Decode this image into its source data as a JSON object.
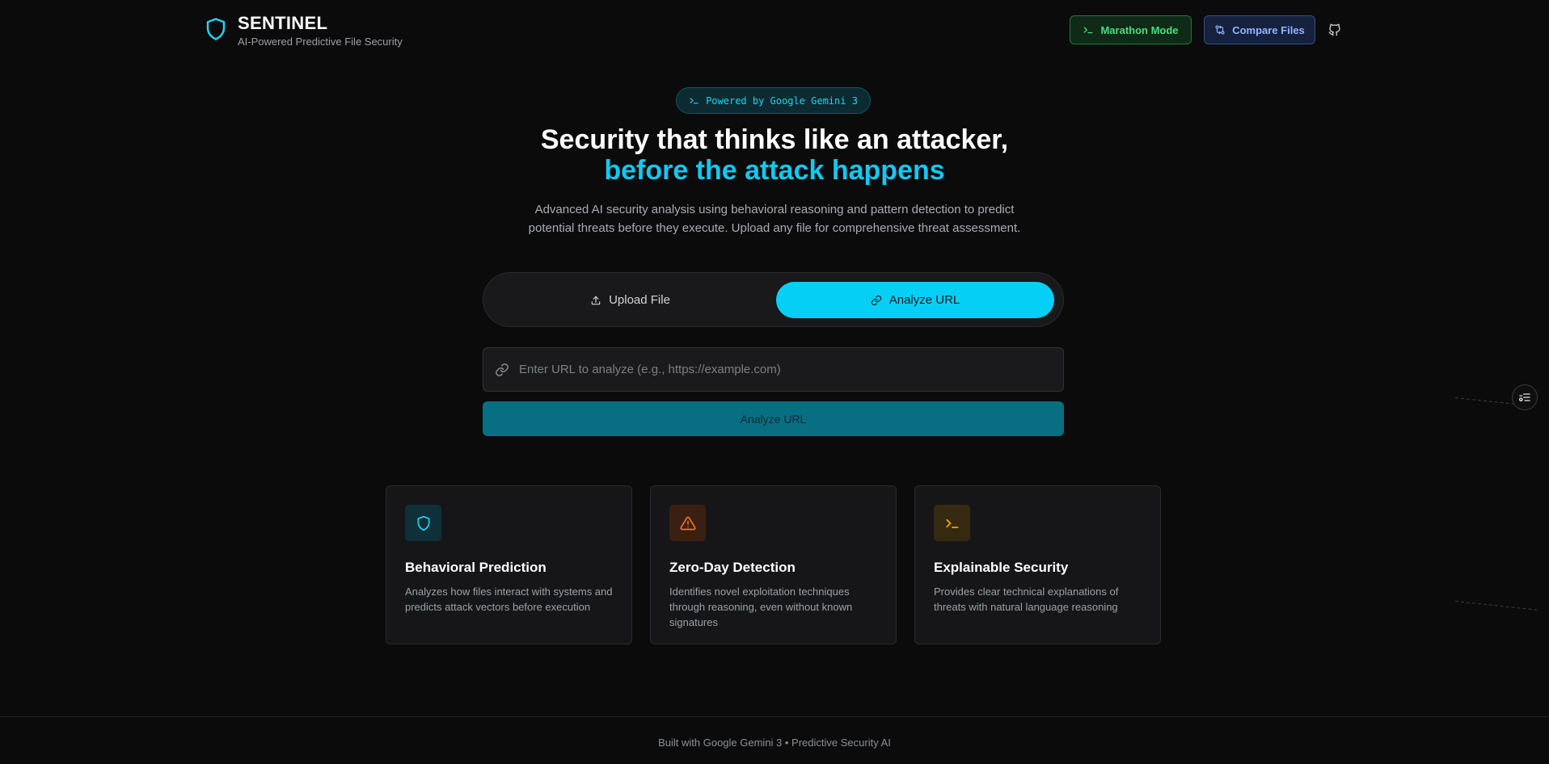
{
  "brand": {
    "title": "SENTINEL",
    "subtitle": "AI-Powered Predictive File Security"
  },
  "header": {
    "marathon_label": "Marathon Mode",
    "compare_label": "Compare Files",
    "github_icon": "github-icon"
  },
  "hero": {
    "badge": "Powered by Google Gemini 3",
    "headline_line1": "Security that thinks like an attacker,",
    "headline_line2": "before the attack happens",
    "description_line1": "Advanced AI security analysis using behavioral reasoning and pattern detection to predict",
    "description_line2": "potential threats before they execute. Upload any file for comprehensive threat assessment."
  },
  "mode_toggle": {
    "tabs": [
      {
        "label": "Upload File",
        "icon": "upload-icon",
        "active": false
      },
      {
        "label": "Analyze URL",
        "icon": "link-icon",
        "active": true
      }
    ]
  },
  "url_input": {
    "placeholder": "Enter URL to analyze (e.g., https://example.com)",
    "value": ""
  },
  "analyze_button": {
    "label": "Analyze URL"
  },
  "features": [
    {
      "title": "Behavioral Prediction",
      "text": "Analyzes how files interact with systems and predicts attack vectors before execution",
      "icon": "shield-icon",
      "color": "#22d3ee"
    },
    {
      "title": "Zero-Day Detection",
      "text": "Identifies novel exploitation techniques through reasoning, even without known signatures",
      "icon": "warning-icon",
      "color": "#f97316"
    },
    {
      "title": "Explainable Security",
      "text": "Provides clear technical explanations of threats with natural language reasoning",
      "icon": "terminal-icon",
      "color": "#f59e0b"
    }
  ],
  "footer": {
    "text": "Built with Google Gemini 3 • Predictive Security AI"
  },
  "colors": {
    "accent": "#06cff5",
    "background": "#0b0b0c"
  }
}
